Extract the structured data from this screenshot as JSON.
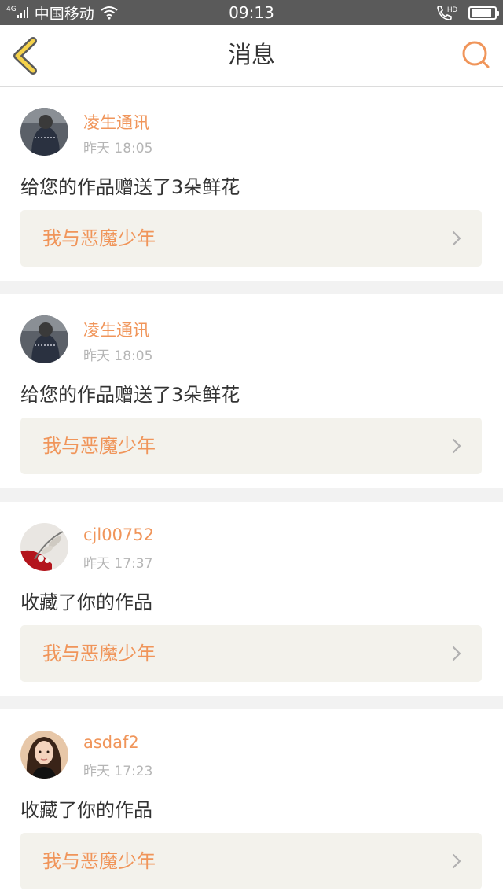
{
  "status_bar": {
    "network_tag": "4G",
    "carrier": "中国移动",
    "time": "09:13",
    "icons": [
      "signal-icon",
      "wifi-icon",
      "call-hd-icon",
      "battery-icon"
    ],
    "battery_level": 0.9
  },
  "header": {
    "title": "消息",
    "back_icon": "chevron-left-icon",
    "search_icon": "search-icon"
  },
  "colors": {
    "accent": "#f0955a",
    "back_arrow": "#f5d24a",
    "status_bar_bg": "#5a5a5a",
    "link_bg": "#f3f2ec"
  },
  "messages": [
    {
      "user": "凌生通讯",
      "time": "昨天 18:05",
      "action": "给您的作品赠送了3朵鲜花",
      "work": "我与恶魔少年"
    },
    {
      "user": "凌生通讯",
      "time": "昨天 18:05",
      "action": "给您的作品赠送了3朵鲜花",
      "work": "我与恶魔少年"
    },
    {
      "user": "cjl00752",
      "time": "昨天 17:37",
      "action": "收藏了你的作品",
      "work": "我与恶魔少年"
    },
    {
      "user": "asdaf2",
      "time": "昨天 17:23",
      "action": "收藏了你的作品",
      "work": "我与恶魔少年"
    }
  ]
}
